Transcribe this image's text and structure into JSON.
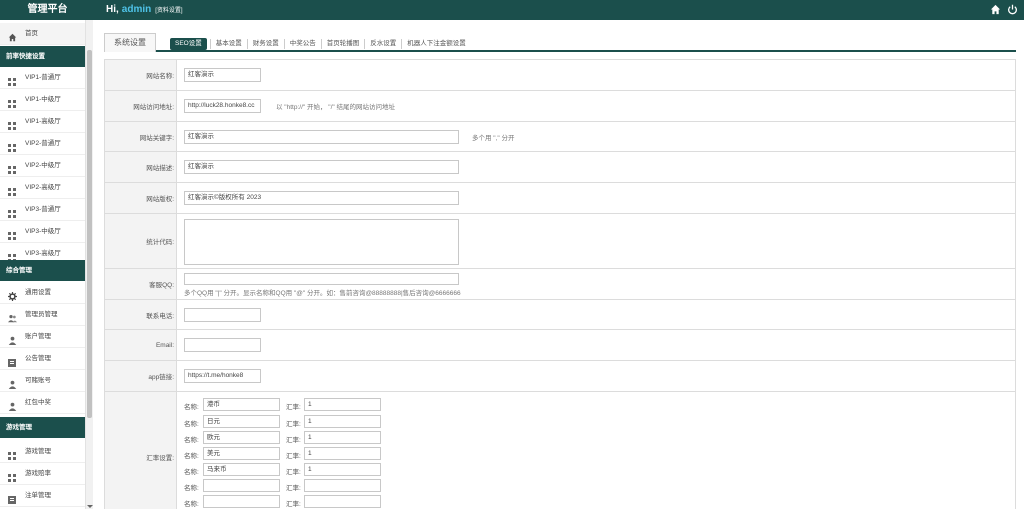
{
  "header": {
    "brand": "管理平台",
    "greeting": "Hi,",
    "username": "admin",
    "profile_link": "[资料设置]"
  },
  "sidebar": {
    "home": "首页",
    "sections": [
      {
        "title": "前率快捷设置",
        "items": [
          "VIP1-普通厅",
          "VIP1-中级厅",
          "VIP1-高级厅",
          "VIP2-普通厅",
          "VIP2-中级厅",
          "VIP2-高级厅",
          "VIP3-普通厅",
          "VIP3-中级厅",
          "VIP3-高级厅"
        ]
      },
      {
        "title": "综合管理",
        "items": [
          "通用设置",
          "管理员管理",
          "账户管理",
          "公告管理",
          "可赌账号",
          "红包中奖"
        ]
      },
      {
        "title": "游戏管理",
        "items": [
          "游戏管理",
          "游戏赔率",
          "注单管理"
        ]
      }
    ]
  },
  "tabs": {
    "main": "系统设置",
    "sub": [
      "SEO设置",
      "基本设置",
      "财务设置",
      "中奖公告",
      "首页轮播图",
      "反水设置",
      "机器人下注金额设置"
    ]
  },
  "form": {
    "site_name": {
      "label": "网站名称:",
      "value": "红客演示"
    },
    "site_url": {
      "label": "网站访问地址:",
      "value": "http://luck28.honke8.cc",
      "hint": "以 \"http://\" 开始， \"/\" 结尾的网站访问地址"
    },
    "keywords": {
      "label": "网站关键字:",
      "value": "红客演示",
      "hint": "多个用 \",\" 分开"
    },
    "description": {
      "label": "网站描述:",
      "value": "红客演示"
    },
    "copyright": {
      "label": "网站版权:",
      "value": "红客演示©版权所有 2023"
    },
    "stats_code": {
      "label": "统计代码:",
      "value": ""
    },
    "qq": {
      "label": "客服QQ:",
      "value": "",
      "hint": "多个QQ用 \"|\" 分开。显示名称和QQ用 \"@\" 分开。如：售前咨询@88888888|售后咨询@6666666"
    },
    "phone": {
      "label": "联系电话:",
      "value": ""
    },
    "email": {
      "label": "Email:",
      "value": ""
    },
    "app_link": {
      "label": "app链接:",
      "value": "https://t.me/honke8"
    },
    "exchange": {
      "label": "汇率设置:",
      "name_label": "名称:",
      "rate_label": "汇率:",
      "rows": [
        {
          "name": "港币",
          "rate": "1"
        },
        {
          "name": "日元",
          "rate": "1"
        },
        {
          "name": "欧元",
          "rate": "1"
        },
        {
          "name": "美元",
          "rate": "1"
        },
        {
          "name": "马来币",
          "rate": "1"
        },
        {
          "name": "",
          "rate": ""
        },
        {
          "name": "",
          "rate": ""
        }
      ]
    }
  },
  "colors": {
    "primary": "#1b4f4c",
    "accent": "#4fc3e8"
  },
  "icons": [
    "home-icon",
    "grid-icon",
    "gear-icon",
    "users-icon",
    "user-icon",
    "bell-icon",
    "logout-icon"
  ]
}
